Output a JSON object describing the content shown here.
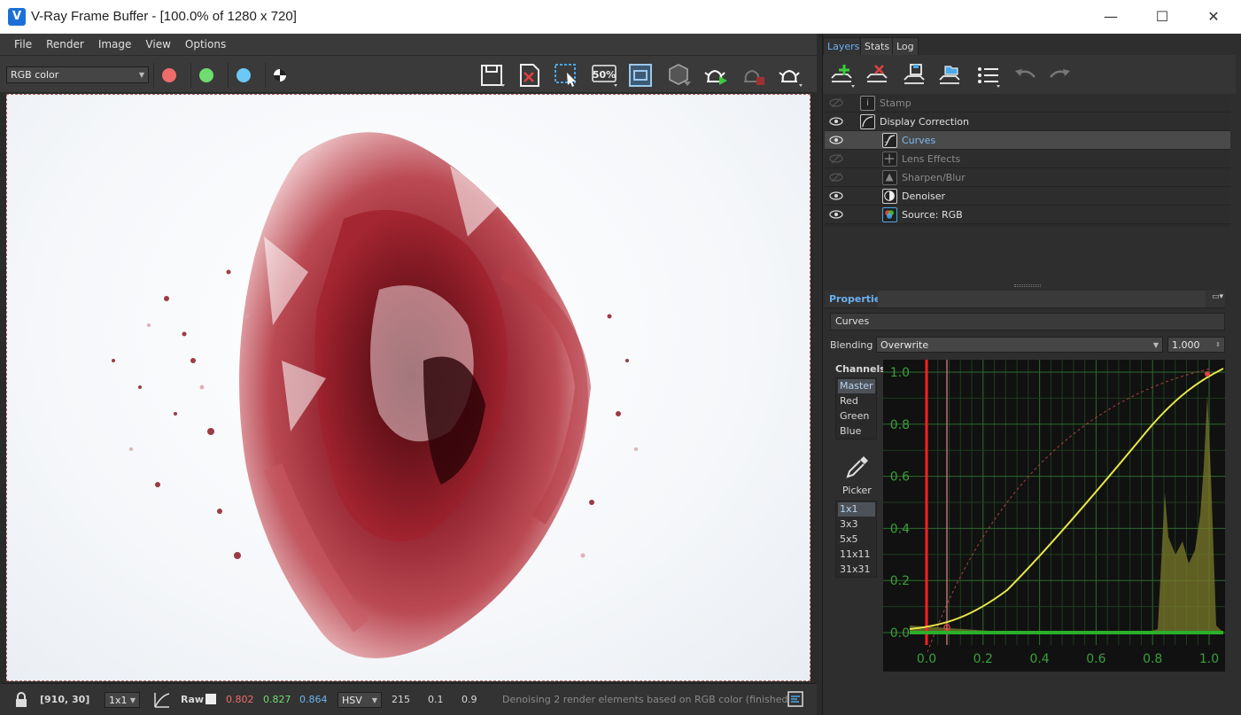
{
  "window": {
    "title": "V-Ray Frame Buffer - [100.0% of 1280 x 720]",
    "minimize": "—",
    "maximize": "☐",
    "close": "✕"
  },
  "menu": [
    "File",
    "Render",
    "Image",
    "View",
    "Options"
  ],
  "toolbar": {
    "channel_select": "RGB color",
    "channel_colors": {
      "red": "#f06b6b",
      "green": "#6fdc6f",
      "blue": "#6cc8f4"
    },
    "zoom_label": "50%"
  },
  "status": {
    "coords": "[910, 30]",
    "sample_size": "1x1",
    "raw_label": "Raw",
    "r": "0.802",
    "g": "0.827",
    "b": "0.864",
    "color_mode": "HSV",
    "h": "215",
    "s": "0.1",
    "v": "0.9",
    "message": "Denoising 2 render elements based on RGB color (finished"
  },
  "tabs": [
    "Layers",
    "Stats",
    "Log"
  ],
  "layers": [
    {
      "name": "Stamp",
      "visible": false,
      "indent": 0,
      "icon": "stamp-icon"
    },
    {
      "name": "Display Correction",
      "visible": true,
      "indent": 0,
      "icon": "display-correction-icon"
    },
    {
      "name": "Curves",
      "visible": true,
      "indent": 1,
      "icon": "curves-icon",
      "selected": true
    },
    {
      "name": "Lens Effects",
      "visible": false,
      "indent": 1,
      "icon": "lens-effects-icon"
    },
    {
      "name": "Sharpen/Blur",
      "visible": false,
      "indent": 1,
      "icon": "sharpen-icon"
    },
    {
      "name": "Denoiser",
      "visible": true,
      "indent": 1,
      "icon": "denoiser-icon"
    },
    {
      "name": "Source: RGB",
      "visible": true,
      "indent": 1,
      "icon": "source-rgb-icon"
    }
  ],
  "properties": {
    "header": "Properties",
    "layer_name": "Curves",
    "blending_label": "Blending",
    "blending_mode": "Overwrite",
    "opacity": "1.000",
    "channels_label": "Channels",
    "channels": [
      "Master",
      "Red",
      "Green",
      "Blue"
    ],
    "picker_label": "Picker",
    "picker_sizes": [
      "1x1",
      "3x3",
      "5x5",
      "11x11",
      "31x31"
    ]
  },
  "curve_graph": {
    "x_ticks": [
      "0.0",
      "0.2",
      "0.4",
      "0.6",
      "0.8",
      "1.0"
    ],
    "y_ticks": [
      "0.0",
      "0.2",
      "0.4",
      "0.6",
      "0.8",
      "1.0"
    ],
    "curve_color": "#e8e84a",
    "histogram_color": "#7a7a2a"
  },
  "colors": {
    "accent": "#6ab0f0",
    "panel_bg": "#2e2e2e",
    "r_value": "#f06b6b",
    "g_value": "#6fdc6f",
    "b_value": "#6cb4f0"
  }
}
